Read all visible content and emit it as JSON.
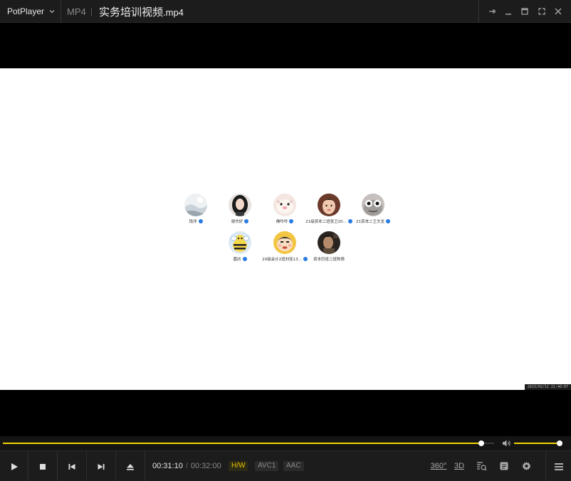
{
  "app": {
    "brand": "PotPlayer",
    "format": "MP4",
    "file_title": "实务培训视频",
    "file_ext": ".mp4"
  },
  "video": {
    "members_row1": [
      {
        "name": "钱洋",
        "avatar": "snow-landscape"
      },
      {
        "name": "谢杰好",
        "avatar": "girl-photo"
      },
      {
        "name": "佛呤呤",
        "avatar": "pink-cat"
      },
      {
        "name": "21级资本二班张卫20...",
        "avatar": "person-photo"
      },
      {
        "name": "21资本二王文龙",
        "avatar": "cartoon-face"
      }
    ],
    "members_row2": [
      {
        "name": "嘉欣",
        "avatar": "bee-cartoon"
      },
      {
        "name": "20级会计2班刘佳13...",
        "avatar": "shinchan"
      },
      {
        "name": "资本历班二班陈倩",
        "avatar": "dark-photo"
      }
    ],
    "timestamp_overlay": "2023/02/11 21:40:07"
  },
  "playback": {
    "current_time": "00:31:10",
    "separator": "/",
    "total_time": "00:32:00",
    "progress": 0.974,
    "volume": 1.0
  },
  "tags": {
    "hw": "H/W",
    "video_codec": "AVC1",
    "audio_codec": "AAC"
  },
  "right_controls": {
    "vr": "360°",
    "three_d": "3D"
  },
  "colors": {
    "accent": "#f5d300",
    "bar_bg": "#1c1c1c",
    "frame_bg": "#ffffff"
  }
}
